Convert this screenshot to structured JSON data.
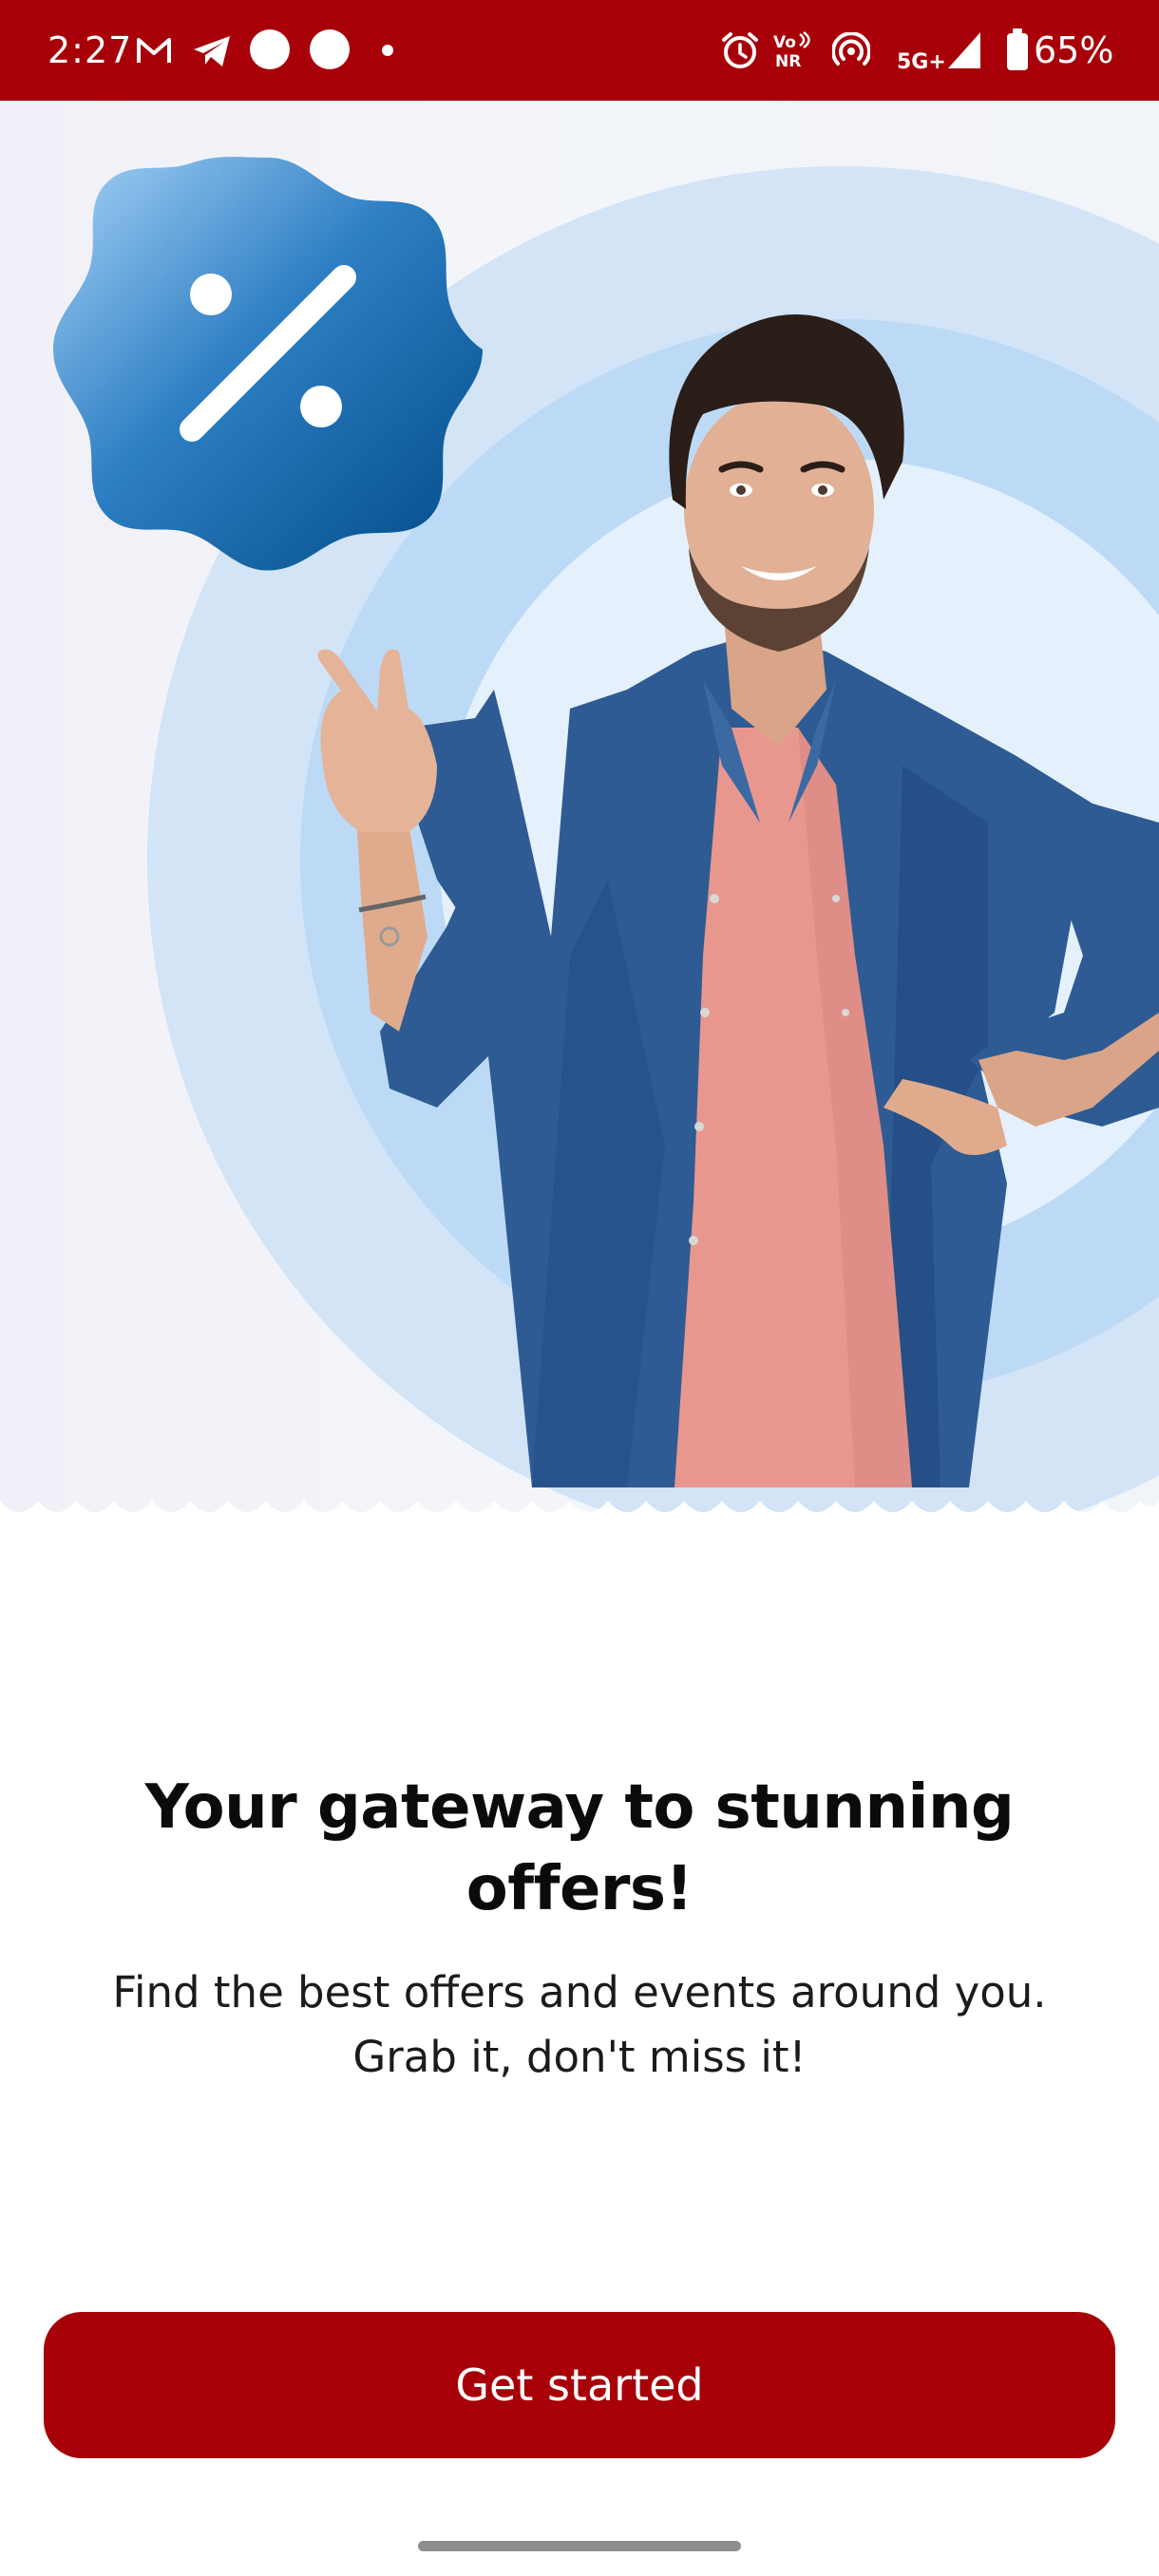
{
  "status_bar": {
    "time": "2:27",
    "battery_percent": "65%",
    "network_label": "5G+",
    "volte_label_top": "Vo",
    "volte_label_bottom": "NR",
    "background_color": "#a80008",
    "icons": [
      "gmail-icon",
      "telegram-icon",
      "notification-dot-icon",
      "notification-dot-icon",
      "more-dot-icon",
      "alarm-icon",
      "volte-icon",
      "hotspot-icon",
      "signal-icon",
      "battery-icon"
    ]
  },
  "hero": {
    "badge_icon": "percent-badge-icon",
    "badge_colors": [
      "#a7d3f7",
      "#005a9e"
    ],
    "illustration": "smiling-man-pointing"
  },
  "content": {
    "headline": "Your gateway to stunning offers!",
    "subtitle_line1": "Find the best offers and events around you.",
    "subtitle_line2": "Grab it, don't miss it!"
  },
  "cta": {
    "label": "Get started",
    "color": "#a80008"
  }
}
